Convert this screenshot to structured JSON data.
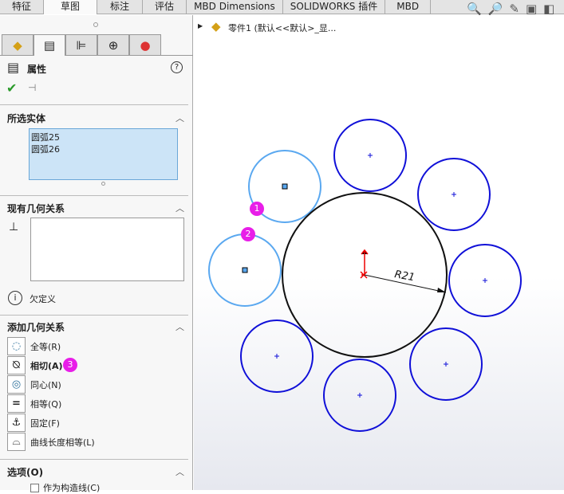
{
  "tabs": [
    "特征",
    "草图",
    "标注",
    "评估",
    "MBD Dimensions",
    "SOLIDWORKS 插件",
    "MBD"
  ],
  "active_tab": "草图",
  "tree": {
    "part_label": "零件1 (默认<<默认>_显..."
  },
  "panel": {
    "title": "属性",
    "selected": {
      "title": "所选实体",
      "items": [
        "圆弧25",
        "圆弧26"
      ]
    },
    "existing": {
      "title": "现有几何关系",
      "status": "欠定义"
    },
    "add": {
      "title": "添加几何关系",
      "items": [
        {
          "label": "全等(R)",
          "icon": "coradial-icon"
        },
        {
          "label": "相切(A)",
          "icon": "tangent-icon"
        },
        {
          "label": "同心(N)",
          "icon": "concentric-icon"
        },
        {
          "label": "相等(Q)",
          "icon": "equal-icon"
        },
        {
          "label": "固定(F)",
          "icon": "fix-icon"
        },
        {
          "label": "曲线长度相等(L)",
          "icon": "equal-curve-length-icon"
        }
      ]
    },
    "options": {
      "title": "选项(O)",
      "checkbox": "作为构造线(C)"
    }
  },
  "sketch": {
    "dimension": "R21"
  },
  "badges": [
    "1",
    "2",
    "3"
  ],
  "colors": {
    "selected": "#5aa8f0",
    "circle": "#1010d8",
    "badge": "#e81ee8"
  }
}
